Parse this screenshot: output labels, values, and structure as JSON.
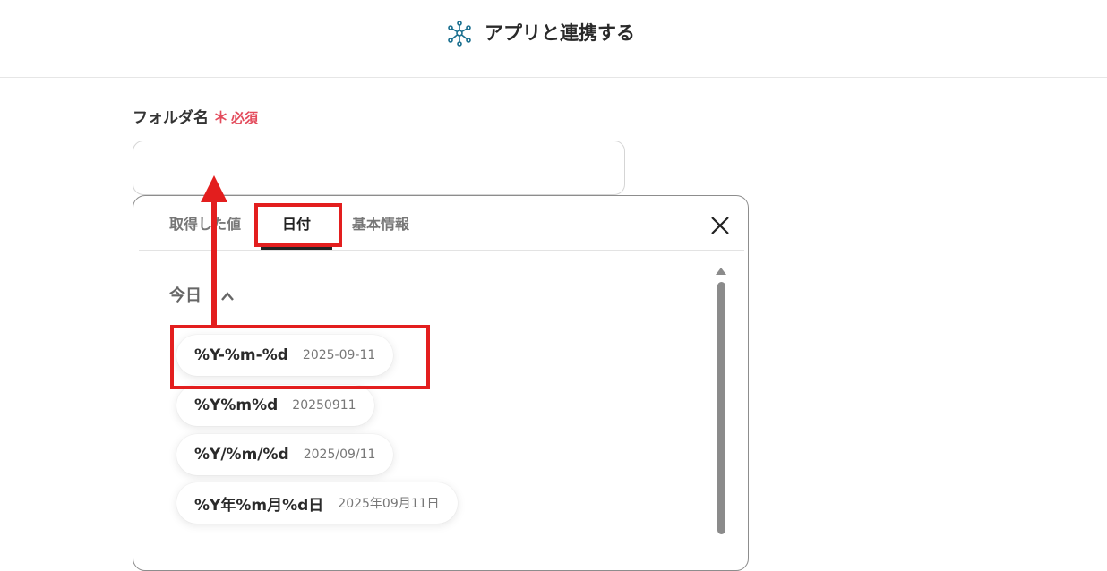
{
  "header": {
    "title": "アプリと連携する",
    "logo_icon": "network-nodes-icon",
    "accent_color": "#1a6f8f"
  },
  "field": {
    "label": "フォルダ名",
    "required_star": "＊",
    "required_text": "必須",
    "value": "",
    "required_color": "#e34b5c"
  },
  "panel": {
    "tabs": [
      {
        "label": "取得した値"
      },
      {
        "label": "日付"
      },
      {
        "label": "基本情報"
      }
    ],
    "active_tab": "日付",
    "close_icon": "close-icon",
    "section": {
      "title": "今日",
      "expanded": true,
      "items": [
        {
          "format": "%Y-%m-%d",
          "example": "2025-09-11"
        },
        {
          "format": "%Y%m%d",
          "example": "20250911"
        },
        {
          "format": "%Y/%m/%d",
          "example": "2025/09/11"
        },
        {
          "format": "%Y年%m月%d日",
          "example": "2025年09月11日"
        }
      ]
    }
  },
  "annotations": {
    "highlight_color": "#e31e1e"
  }
}
